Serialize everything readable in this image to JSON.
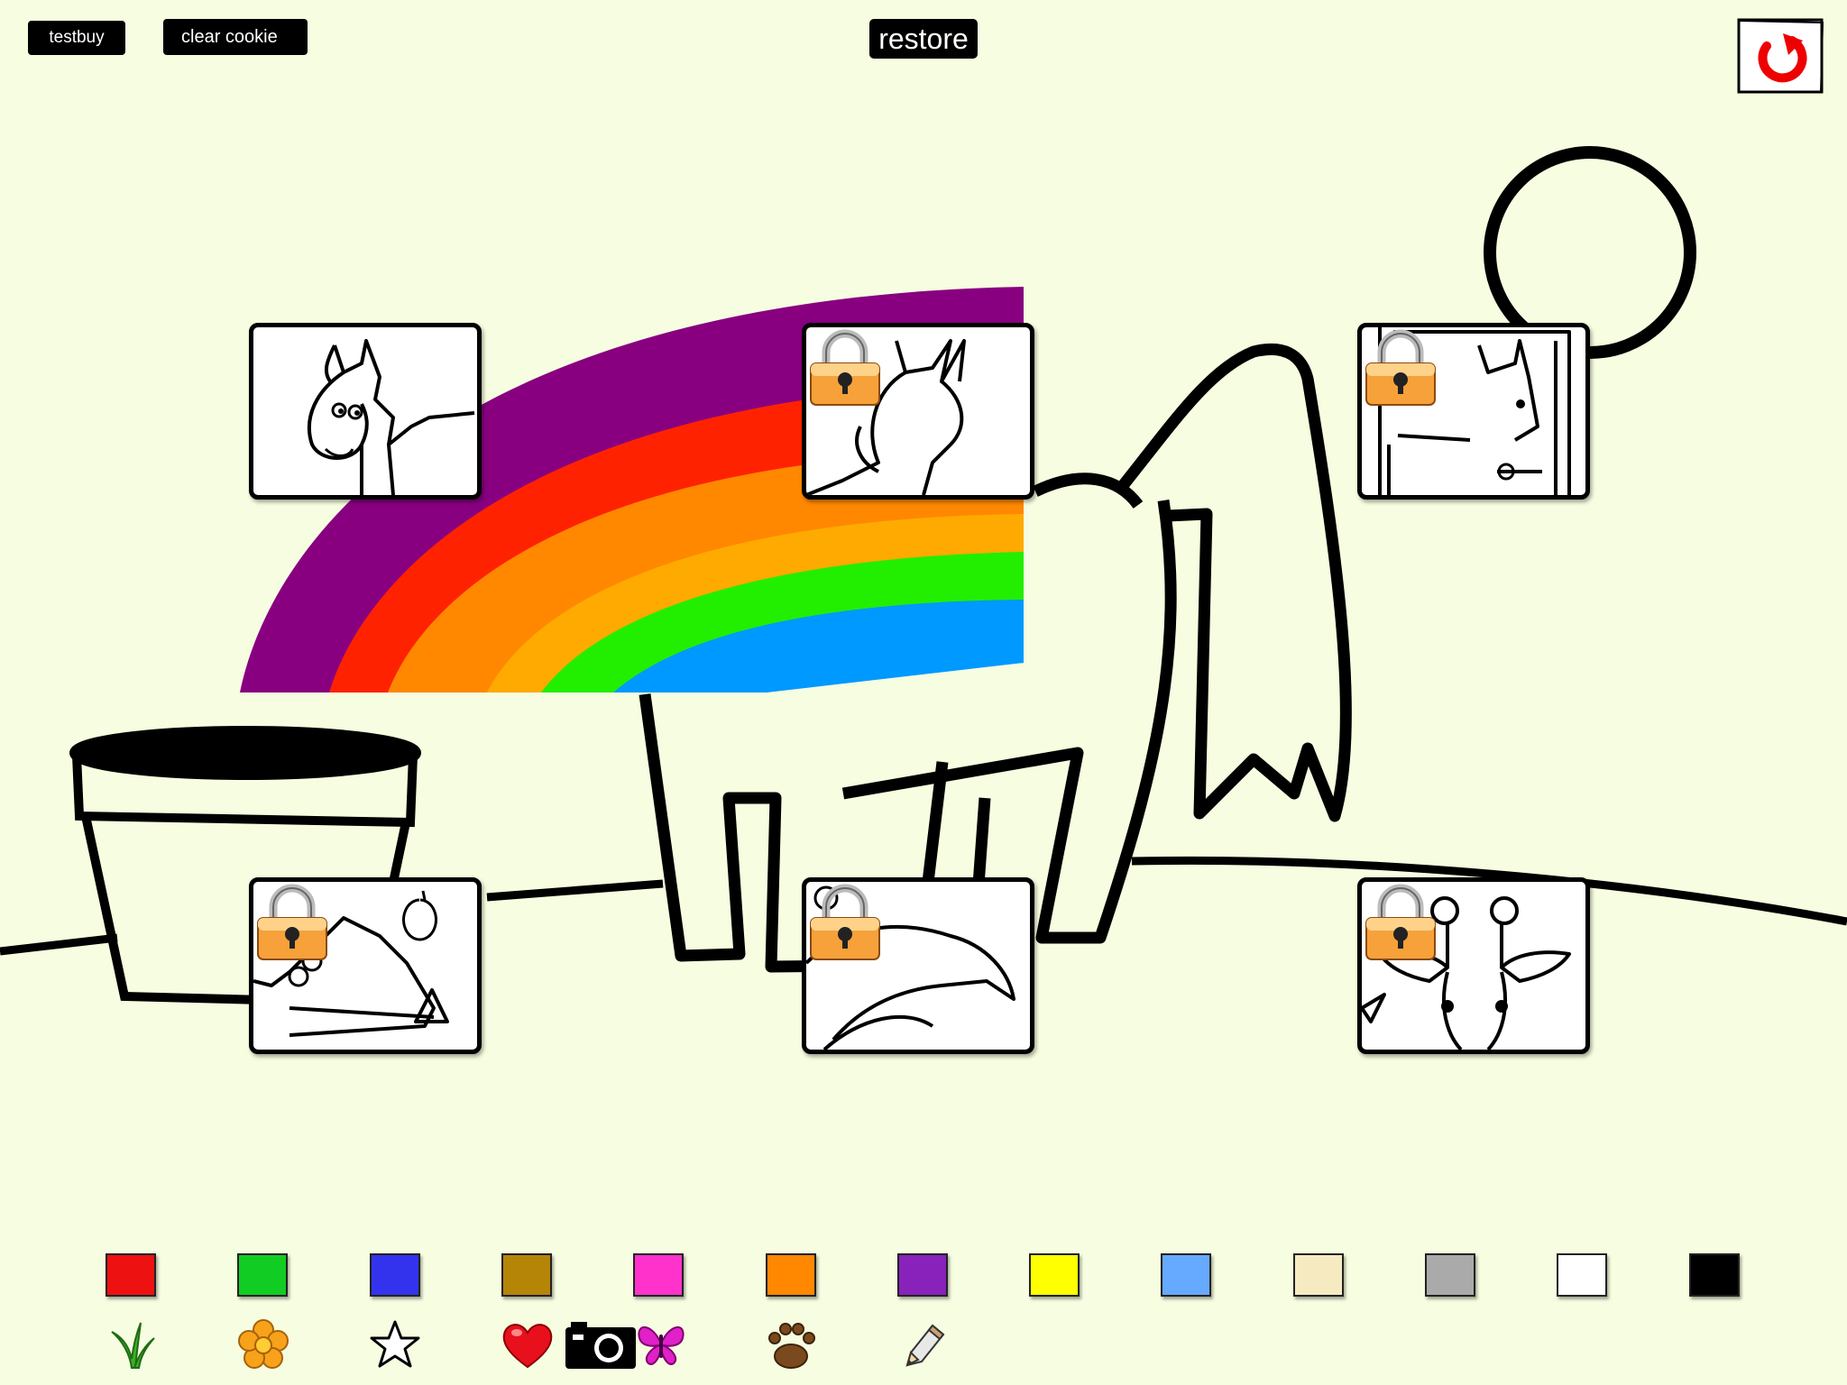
{
  "toolbar": {
    "testbuy_label": "testbuy",
    "clear_cookie_label": "clear cookie",
    "restore_label": "restore",
    "undo_icon": "undo-icon"
  },
  "pages": [
    {
      "subject": "horse",
      "locked": false
    },
    {
      "subject": "unicorn",
      "locked": true
    },
    {
      "subject": "horse-in-stable",
      "locked": true
    },
    {
      "subject": "crocodile",
      "locked": true
    },
    {
      "subject": "dolphin",
      "locked": true
    },
    {
      "subject": "giraffe",
      "locked": true
    }
  ],
  "palette": {
    "colors": [
      "#ee1111",
      "#11cc22",
      "#3333ee",
      "#b58508",
      "#ff33cc",
      "#ff8800",
      "#8822bb",
      "#ffff00",
      "#66aaff",
      "#f6ebc0",
      "#aaaaaa",
      "#ffffff",
      "#000000"
    ]
  },
  "stamps": [
    "grass-stamp-icon",
    "flower-stamp-icon",
    "star-stamp-icon",
    "heart-stamp-icon",
    "camera-icon",
    "butterfly-stamp-icon",
    "paw-stamp-icon",
    "pencil-icon"
  ],
  "colors": {
    "background": "#f6fde0",
    "rainbow": [
      "#880080",
      "#ff2200",
      "#ff8800",
      "#ffaa00",
      "#22ee00",
      "#0099ff"
    ]
  }
}
